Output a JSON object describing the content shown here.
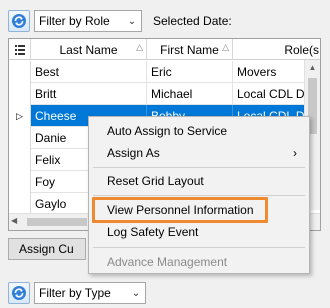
{
  "top_bar": {
    "filter_value": "Filter by Role",
    "selected_date_label": "Selected Date:"
  },
  "grid": {
    "columns": [
      "Last Name",
      "First Name",
      "Role(s"
    ],
    "rows": [
      {
        "last": "Best",
        "first": "Eric",
        "role": "Movers"
      },
      {
        "last": "Britt",
        "first": "Michael",
        "role": "Local CDL D"
      },
      {
        "last": "Cheese",
        "first": "Bobby",
        "role": "Local CDL D"
      },
      {
        "last": "Danie",
        "first": "",
        "role": ""
      },
      {
        "last": "Felix",
        "first": "",
        "role": ""
      },
      {
        "last": "Foy",
        "first": "",
        "role": ""
      },
      {
        "last": "Gaylo",
        "first": "",
        "role": ""
      }
    ]
  },
  "assign_button": {
    "label": "Assign Cu"
  },
  "context_menu": {
    "items": [
      "Auto Assign to Service",
      "Assign As",
      "Reset Grid Layout",
      "View Personnel Information",
      "Log Safety Event",
      "Advance Management"
    ],
    "highlighted_item": "View Personnel Information",
    "highlight_color": "#f08a30"
  },
  "bottom_bar": {
    "filter_value": "Filter by Type"
  },
  "colors": {
    "selection": "#0078d7",
    "window_bg": "#f0f0f0"
  }
}
